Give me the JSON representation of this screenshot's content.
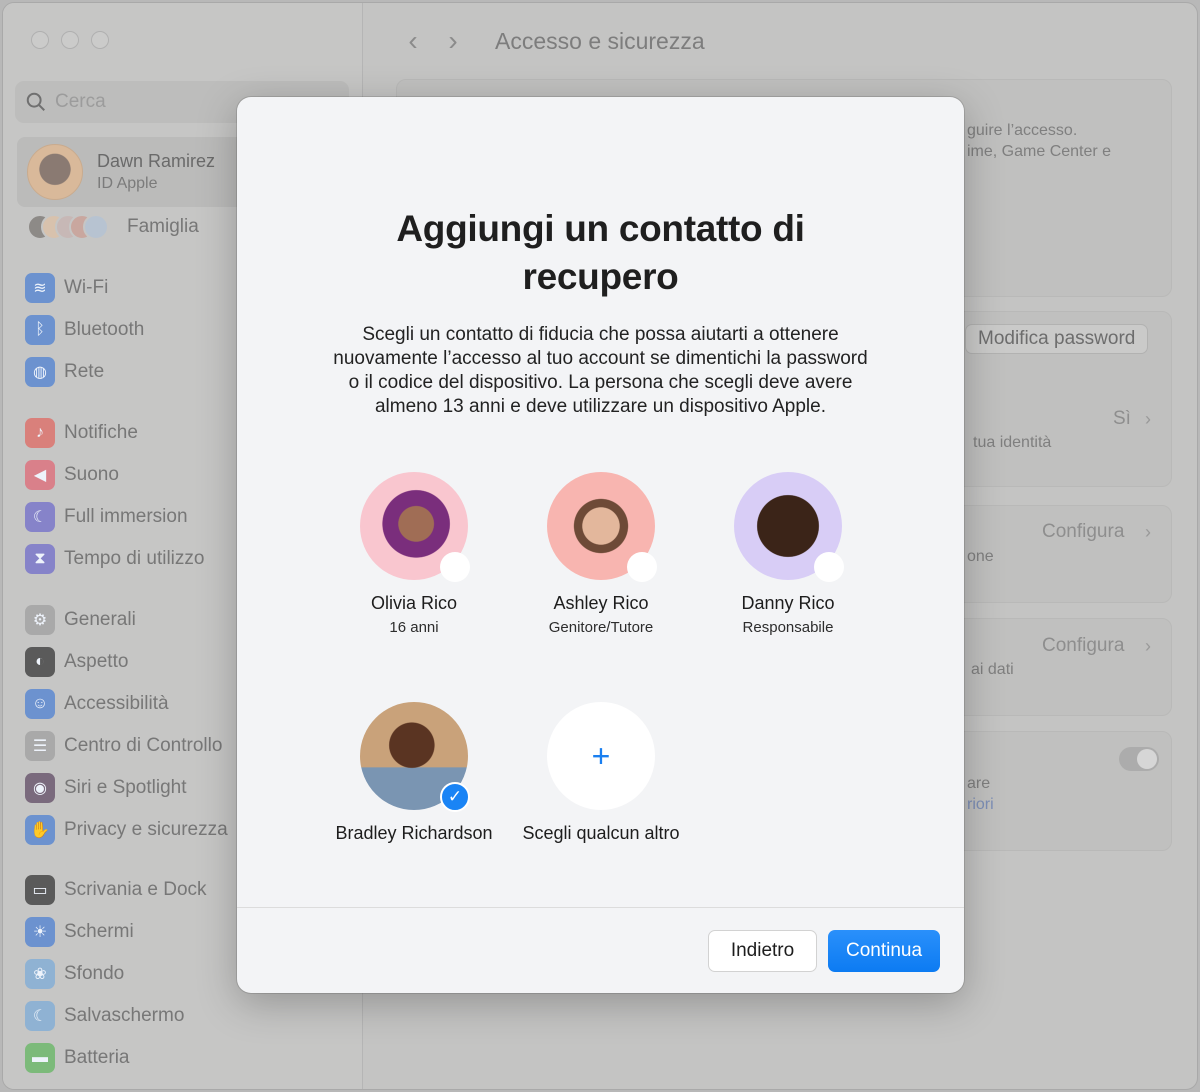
{
  "window": {
    "traffic_lights": [
      "close",
      "minimize",
      "zoom"
    ]
  },
  "sidebar": {
    "search": {
      "placeholder": "Cerca",
      "value": "",
      "icon": "search-icon"
    },
    "account": {
      "name": "Dawn Ramirez",
      "subtitle": "ID Apple"
    },
    "family": {
      "label": "Famiglia"
    },
    "groups": [
      [
        {
          "label": "Wi-Fi",
          "icon": "wifi-icon",
          "color": "#6c92cf",
          "glyph": "≋"
        },
        {
          "label": "Bluetooth",
          "icon": "bluetooth-icon",
          "color": "#6c92cf",
          "glyph": "ᛒ"
        },
        {
          "label": "Rete",
          "icon": "globe-icon",
          "color": "#6c92cf",
          "glyph": "◍"
        }
      ],
      [
        {
          "label": "Notifiche",
          "icon": "bell-icon",
          "color": "#d9807b",
          "glyph": "♪"
        },
        {
          "label": "Suono",
          "icon": "speaker-icon",
          "color": "#d9808a",
          "glyph": "◀"
        },
        {
          "label": "Full immersion",
          "icon": "moon-icon",
          "color": "#8683c9",
          "glyph": "☾"
        },
        {
          "label": "Tempo di utilizzo",
          "icon": "hourglass-icon",
          "color": "#8683c9",
          "glyph": "⧗"
        }
      ],
      [
        {
          "label": "Generali",
          "icon": "gear-icon",
          "color": "#a9a9a9",
          "glyph": "⚙"
        },
        {
          "label": "Aspetto",
          "icon": "appearance-icon",
          "color": "#5a5a5a",
          "glyph": "◐"
        },
        {
          "label": "Accessibilità",
          "icon": "accessibility-icon",
          "color": "#6c92cf",
          "glyph": "☺"
        },
        {
          "label": "Centro di Controllo",
          "icon": "control-center-icon",
          "color": "#a9a9a9",
          "glyph": "☰"
        },
        {
          "label": "Siri e Spotlight",
          "icon": "siri-icon",
          "color": "#7a6a7d",
          "glyph": "◉"
        },
        {
          "label": "Privacy e sicurezza",
          "icon": "hand-icon",
          "color": "#6c92cf",
          "glyph": "✋"
        }
      ],
      [
        {
          "label": "Scrivania e Dock",
          "icon": "dock-icon",
          "color": "#5a5a5a",
          "glyph": "▭"
        },
        {
          "label": "Schermi",
          "icon": "brightness-icon",
          "color": "#6c92cf",
          "glyph": "☀"
        },
        {
          "label": "Sfondo",
          "icon": "wallpaper-icon",
          "color": "#8fb2d3",
          "glyph": "❀"
        },
        {
          "label": "Salvaschermo",
          "icon": "screensaver-icon",
          "color": "#8fb2d3",
          "glyph": "☾"
        },
        {
          "label": "Batteria",
          "icon": "battery-icon",
          "color": "#7cba7a",
          "glyph": "▬"
        }
      ]
    ]
  },
  "main": {
    "toolbar": {
      "back": "‹",
      "forward": "›",
      "title": "Accesso e sicurezza"
    },
    "background_fragments": {
      "text1": "guire l’accesso.",
      "text2": "ime, Game Center e",
      "change_password": "Modifica password",
      "row1_value": "Sì",
      "row1_text": "tua identità",
      "row2_value": "Configura",
      "row2_text": "one",
      "row3_value": "Configura",
      "row3_text": "ai dati",
      "row4_text": "are",
      "row4_link": "riori",
      "toggle_on": true
    }
  },
  "modal": {
    "title": "Aggiungi un contatto di recupero",
    "description": "Scegli un contatto di fiducia che possa aiutarti a ottenere nuovamente l’accesso al tuo account se dimentichi la password o il codice del dispositivo. La persona che scegli deve avere almeno 13 anni e deve utilizzare un dispositivo Apple.",
    "contacts": [
      {
        "name": "Olivia Rico",
        "subtitle": "16 anni",
        "selected": false,
        "bg": "#f9c6cf"
      },
      {
        "name": "Ashley Rico",
        "subtitle": "Genitore/Tutore",
        "selected": false,
        "bg": "#f8b5b0"
      },
      {
        "name": "Danny Rico",
        "subtitle": "Responsabile",
        "selected": false,
        "bg": "#d8cdf6"
      },
      {
        "name": "Bradley Richardson",
        "subtitle": "",
        "selected": true,
        "bg": "#b58f6d"
      }
    ],
    "add_other": {
      "label": "Scegli qualcun altro",
      "glyph": "+"
    },
    "buttons": {
      "back": "Indietro",
      "continue": "Continua"
    },
    "accent": "#1a84f5"
  }
}
